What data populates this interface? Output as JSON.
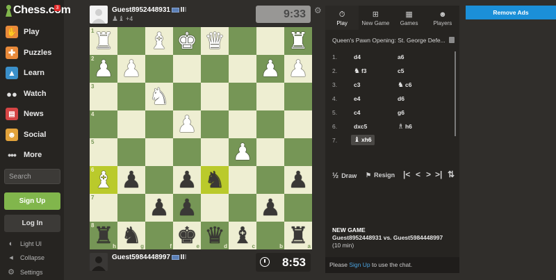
{
  "app": {
    "logo_text": "Chess.com",
    "notification_count": "3"
  },
  "sidebar": {
    "items": [
      {
        "label": "Play",
        "icon": "play-hand-icon",
        "color": "#e98a3a"
      },
      {
        "label": "Puzzles",
        "icon": "puzzle-icon",
        "color": "#e98a3a"
      },
      {
        "label": "Learn",
        "icon": "graduation-cap-icon",
        "color": "#3a8fc9"
      },
      {
        "label": "Watch",
        "icon": "binoculars-icon",
        "color": "#e0e0e0"
      },
      {
        "label": "News",
        "icon": "newspaper-icon",
        "color": "#d64545"
      },
      {
        "label": "Social",
        "icon": "people-icon",
        "color": "#e2a23a"
      },
      {
        "label": "More",
        "icon": "more-dots-icon",
        "color": "#cfcfcf"
      }
    ],
    "search_placeholder": "Search",
    "signup_label": "Sign Up",
    "login_label": "Log In",
    "footer": [
      {
        "label": "Light UI",
        "icon": "contrast-icon"
      },
      {
        "label": "Collapse",
        "icon": "collapse-arrow-icon"
      },
      {
        "label": "Settings",
        "icon": "settings-gear-icon"
      }
    ]
  },
  "players": {
    "top": {
      "name": "Guest8952448931",
      "captured_extra": "+4",
      "clock": "9:33"
    },
    "bottom": {
      "name": "Guest5984448997",
      "clock": "8:53"
    }
  },
  "board": {
    "orientation": "black-bottom",
    "rank_labels": [
      "1",
      "2",
      "3",
      "4",
      "5",
      "6",
      "7",
      "8"
    ],
    "file_labels": [
      "h",
      "g",
      "f",
      "e",
      "d",
      "c",
      "b",
      "a"
    ],
    "highlight_squares": [
      "d6",
      "h6"
    ],
    "rows": [
      [
        "wR",
        "",
        "wB",
        "wK",
        "wQ",
        "",
        "",
        "wR"
      ],
      [
        "wP",
        "wP",
        "",
        "",
        "",
        "",
        "wP",
        "wP"
      ],
      [
        "",
        "",
        "wN",
        "",
        "",
        "",
        "",
        ""
      ],
      [
        "",
        "",
        "",
        "wP",
        "",
        "",
        "",
        ""
      ],
      [
        "",
        "",
        "",
        "",
        "",
        "wP",
        "",
        ""
      ],
      [
        "wB",
        "bP",
        "",
        "bP",
        "bN",
        "",
        "",
        "bP"
      ],
      [
        "",
        "",
        "bP",
        "bP",
        "",
        "",
        "bP",
        ""
      ],
      [
        "bR",
        "bN",
        "",
        "bK",
        "bQ",
        "bB",
        "",
        "bR"
      ]
    ]
  },
  "panel": {
    "tabs": [
      {
        "label": "Play",
        "icon": "stopwatch-icon",
        "active": true
      },
      {
        "label": "New Game",
        "icon": "plus-square-icon",
        "active": false
      },
      {
        "label": "Games",
        "icon": "board-grid-icon",
        "active": false
      },
      {
        "label": "Players",
        "icon": "two-people-icon",
        "active": false
      }
    ],
    "opening": "Queen's Pawn Opening: St. George Defe...",
    "moves": [
      {
        "num": "1.",
        "white": "d4",
        "black": "a6"
      },
      {
        "num": "2.",
        "white_piece": "♞",
        "white": "f3",
        "black": "c5"
      },
      {
        "num": "3.",
        "white": "c3",
        "black_piece": "♞",
        "black": "c6"
      },
      {
        "num": "4.",
        "white": "e4",
        "black": "d6"
      },
      {
        "num": "5.",
        "white": "c4",
        "black": "g6"
      },
      {
        "num": "6.",
        "white": "dxc5",
        "black_piece": "♗",
        "black": "h6"
      },
      {
        "num": "7.",
        "white_piece": "♝",
        "white": "xh6",
        "black": ""
      }
    ],
    "draw_label": "Draw",
    "draw_prefix": "½",
    "resign_label": "Resign",
    "newgame_title": "NEW GAME",
    "newgame_players": "Guest8952448931 vs. Guest5984448997",
    "newgame_time": "(10 min)",
    "chat_prefix": "Please ",
    "chat_link": "Sign Up",
    "chat_suffix": " to use the chat."
  },
  "ads": {
    "remove_label": "Remove Ads"
  }
}
